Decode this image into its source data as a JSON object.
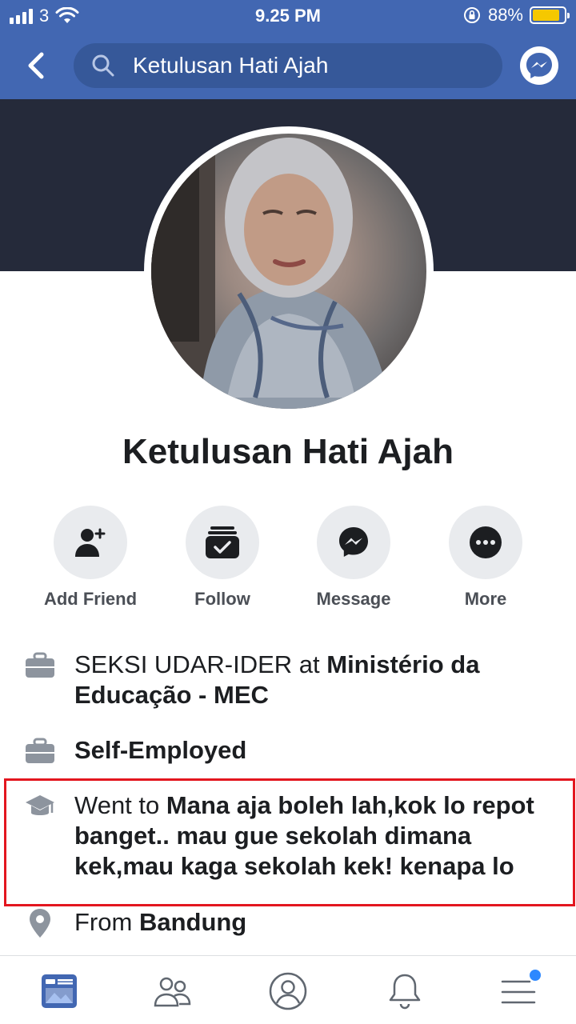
{
  "status_bar": {
    "carrier": "3",
    "time": "9.25 PM",
    "battery_percent": "88%",
    "battery_level": 0.88
  },
  "header": {
    "search_text": "Ketulusan Hati Ajah",
    "colors": {
      "bar": "#4267b2",
      "search_bg": "#365899"
    }
  },
  "profile": {
    "name": "Ketulusan Hati Ajah"
  },
  "actions": [
    {
      "label": "Add Friend",
      "icon": "add-friend-icon"
    },
    {
      "label": "Follow",
      "icon": "follow-icon"
    },
    {
      "label": "Message",
      "icon": "messenger-icon"
    },
    {
      "label": "More",
      "icon": "more-icon"
    }
  ],
  "info": {
    "work1": {
      "prefix": "SEKSI UDAR-IDER at ",
      "bold": "Ministério da Educação - MEC"
    },
    "work2": {
      "bold": "Self-Employed"
    },
    "education": {
      "prefix": "Went to ",
      "bold": "Mana aja boleh lah,kok lo repot banget.. mau gue sekolah dimana kek,mau kaga sekolah kek! kenapa lo"
    },
    "location": {
      "prefix": "From ",
      "bold": "Bandung"
    }
  },
  "tabs": [
    "news-feed-icon",
    "friends-icon",
    "profile-icon",
    "notifications-icon",
    "menu-icon"
  ],
  "highlight_color": "#e3161f"
}
